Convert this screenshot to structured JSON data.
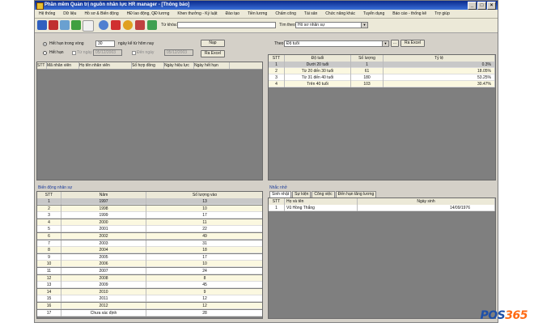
{
  "window": {
    "title": "Phần mềm Quản trị nguồn nhân lực HR manager - [Thông báo]"
  },
  "menu": [
    "Hệ thống",
    "Dữ liệu",
    "Hồ sơ & Biến động",
    "HĐ lao động, QĐ lương",
    "Khen thưởng - Kỷ luật",
    "Đào tạo",
    "Tiền lương",
    "Chấm công",
    "Tài sản",
    "Chức năng khác",
    "Tuyển dụng",
    "Báo cáo - thống kê",
    "Trợ giúp"
  ],
  "toolbar": {
    "keyword_label": "Từ khóa:",
    "search_by_label": "Tìm theo",
    "search_by_value": "Hồ sơ nhân sự"
  },
  "contract_filter": {
    "option_within": "Hết hạn trong vòng",
    "days_value": "30",
    "days_suffix": "ngày kể từ hôm nay",
    "option_expired": "Hết hạn",
    "from_label": "Từ ngày",
    "from_value": "05/12/2003",
    "to_label": "Đến ngày",
    "to_value": "05/12/2003",
    "load_button": "Nạp",
    "export_button": "Ra Excel"
  },
  "contract_grid": {
    "headers": [
      "STT",
      "Mã nhân viên",
      "Họ tên nhân viên",
      "Số hợp đồng",
      "Ngày hiệu lực",
      "Ngày hết hạn"
    ]
  },
  "age_panel": {
    "by_label": "Theo",
    "by_value": "Độ tuổi",
    "export_button": "Ra Excel",
    "headers": [
      "STT",
      "Độ tuổi",
      "Số lượng",
      "Tỷ lệ"
    ],
    "rows": [
      {
        "stt": "1",
        "group": "Dưới 20 tuổi",
        "count": "1",
        "pct": "0.3%"
      },
      {
        "stt": "2",
        "group": "Từ 20 đến 30 tuổi",
        "count": "61",
        "pct": "18.05%"
      },
      {
        "stt": "3",
        "group": "Từ 31 đến 40 tuổi",
        "count": "180",
        "pct": "53.25%"
      },
      {
        "stt": "4",
        "group": "Trên 40 tuổi",
        "count": "103",
        "pct": "30.47%"
      }
    ]
  },
  "movement_panel": {
    "caption": "Biến động nhân sự",
    "headers": [
      "STT",
      "Năm",
      "Số lượng vào"
    ],
    "rows": [
      {
        "stt": "1",
        "year": "1997",
        "count": "13"
      },
      {
        "stt": "2",
        "year": "1998",
        "count": "10"
      },
      {
        "stt": "3",
        "year": "1999",
        "count": "17"
      },
      {
        "stt": "4",
        "year": "2000",
        "count": "11"
      },
      {
        "stt": "5",
        "year": "2001",
        "count": "22"
      },
      {
        "stt": "6",
        "year": "2002",
        "count": "49"
      },
      {
        "stt": "7",
        "year": "2003",
        "count": "31"
      },
      {
        "stt": "8",
        "year": "2004",
        "count": "18"
      },
      {
        "stt": "9",
        "year": "2005",
        "count": "17"
      },
      {
        "stt": "10",
        "year": "2006",
        "count": "10"
      },
      {
        "stt": "11",
        "year": "2007",
        "count": "24"
      },
      {
        "stt": "12",
        "year": "2008",
        "count": "8"
      },
      {
        "stt": "13",
        "year": "2009",
        "count": "45"
      },
      {
        "stt": "14",
        "year": "2010",
        "count": "9"
      },
      {
        "stt": "15",
        "year": "2011",
        "count": "12"
      },
      {
        "stt": "16",
        "year": "2012",
        "count": "12"
      },
      {
        "stt": "17",
        "year": "Chưa xác định",
        "count": "28"
      }
    ]
  },
  "reminder_panel": {
    "caption": "Nhắc nhở",
    "tabs": [
      "Sinh nhật",
      "Sự kiện",
      "Công việc",
      "Đến hạn tăng lương"
    ],
    "headers": [
      "STT",
      "Họ và tên",
      "Ngày sinh"
    ],
    "rows": [
      {
        "stt": "1",
        "name": "Vũ Hồng Thắng",
        "dob": "14/09/1976"
      }
    ]
  },
  "brand": {
    "watermark_prefix": "POS",
    "watermark_suffix": "365"
  }
}
